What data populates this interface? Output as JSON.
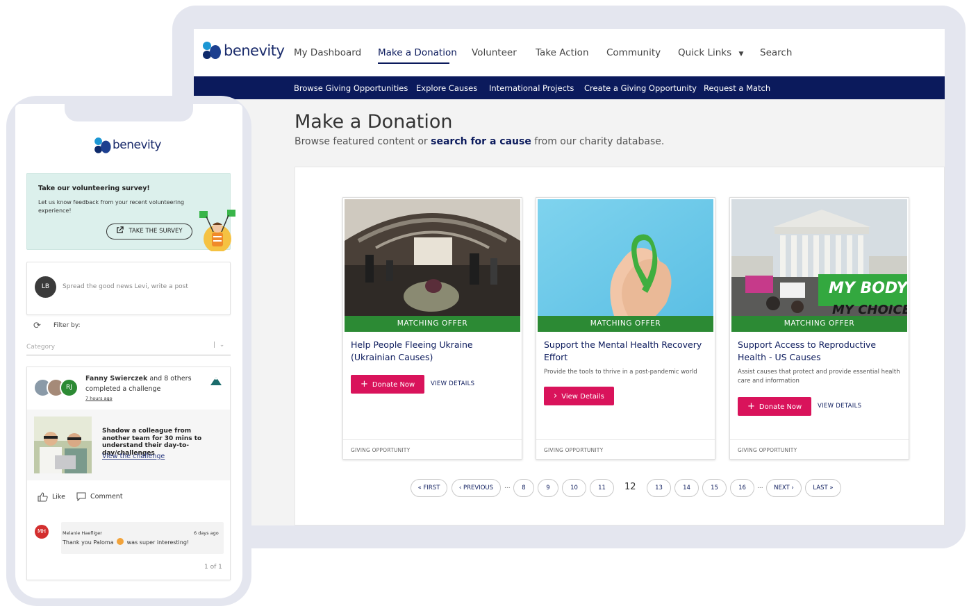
{
  "desktop": {
    "logo": "benevity",
    "nav": [
      {
        "label": "My Dashboard"
      },
      {
        "label": "Make a Donation",
        "active": true
      },
      {
        "label": "Volunteer"
      },
      {
        "label": "Take Action"
      },
      {
        "label": "Community"
      },
      {
        "label": "Quick Links"
      },
      {
        "label": "Search"
      }
    ],
    "subnav": [
      "Browse Giving Opportunities",
      "Explore Causes",
      "International Projects",
      "Create a Giving Opportunity",
      "Request a Match"
    ],
    "page_title": "Make a Donation",
    "subtitle_pre": "Browse featured content or ",
    "subtitle_link": "search for a cause",
    "subtitle_post": " from our charity database.",
    "cards": [
      {
        "badge": "MATCHING OFFER",
        "title": "Help People Fleeing Ukraine (Ukrainian Causes)",
        "description": "",
        "button": "Donate Now",
        "details": "VIEW DETAILS",
        "footer": "GIVING OPPORTUNITY"
      },
      {
        "badge": "MATCHING OFFER",
        "title": "Support the Mental Health Recovery Effort",
        "description": "Provide the tools to thrive in a post-pandemic world",
        "button": "View Details",
        "details": "",
        "footer": "GIVING OPPORTUNITY"
      },
      {
        "badge": "MATCHING OFFER",
        "title": "Support Access to Reproductive Health - US Causes",
        "description": "Assist causes that protect and provide essential health care and information",
        "button": "Donate Now",
        "details": "VIEW DETAILS",
        "footer": "GIVING OPPORTUNITY"
      }
    ],
    "pagination": {
      "first": "« FIRST",
      "prev": "‹ PREVIOUS",
      "ellipsis": "...",
      "pages_before": [
        "8",
        "9",
        "10",
        "11"
      ],
      "current": "12",
      "pages_after": [
        "13",
        "14",
        "15",
        "16"
      ],
      "next": "NEXT ›",
      "last": "LAST »"
    },
    "colors": {
      "navy": "#0b1a5c",
      "green": "#2c8a34",
      "pink": "#d9135b"
    }
  },
  "mobile": {
    "logo": "benevity",
    "survey": {
      "title": "Take our volunteering survey!",
      "text": "Let us know feedback from your recent volunteering experience!",
      "button": "TAKE THE SURVEY"
    },
    "post": {
      "avatar": "LB",
      "placeholder": "Spread the good news Levi, write a post"
    },
    "filter": {
      "label": "Filter by:",
      "category_placeholder": "Category"
    },
    "feed": {
      "avatar_initials": "RJ",
      "who_name": "Fanny Swierczek",
      "who_rest": " and 8 others",
      "action": "completed a challenge",
      "time": "7 hours ago",
      "challenge_title": "Shadow a colleague from another team for 30 mins to understand their day-to-day/challenges",
      "challenge_link": "View the challenge",
      "like": "Like",
      "comment": "Comment"
    },
    "comment": {
      "avatar": "MH",
      "name": "Melanie Haefliger",
      "time": "6 days ago",
      "text_pre": "Thank you Paloma",
      "text_post": "was super interesting!"
    },
    "page_of": "1 of 1"
  }
}
